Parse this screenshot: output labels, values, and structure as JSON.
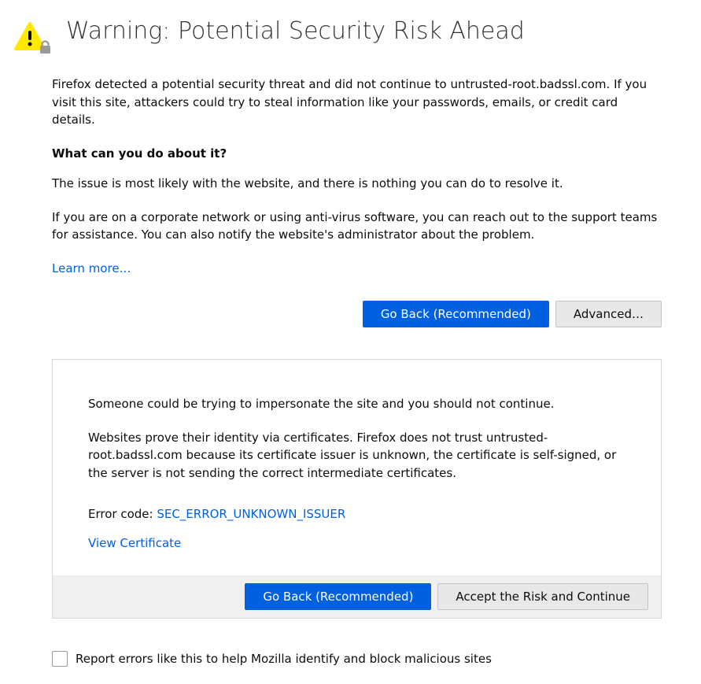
{
  "header": {
    "title": "Warning: Potential Security Risk Ahead"
  },
  "intro": "Firefox detected a potential security threat and did not continue to untrusted-root.badssl.com. If you visit this site, attackers could try to steal information like your passwords, emails, or credit card details.",
  "what_heading": "What can you do about it?",
  "what_line1": "The issue is most likely with the website, and there is nothing you can do to resolve it.",
  "what_line2": "If you are on a corporate network or using anti-virus software, you can reach out to the support teams for assistance. You can also notify the website's administrator about the problem.",
  "learn_more": "Learn more…",
  "buttons": {
    "go_back": "Go Back (Recommended)",
    "advanced": "Advanced…",
    "accept_risk": "Accept the Risk and Continue"
  },
  "advanced": {
    "line1": "Someone could be trying to impersonate the site and you should not continue.",
    "line2": "Websites prove their identity via certificates. Firefox does not trust untrusted-root.badssl.com because its certificate issuer is unknown, the certificate is self-signed, or the server is not sending the correct intermediate certificates.",
    "error_code_label": "Error code: ",
    "error_code": "SEC_ERROR_UNKNOWN_ISSUER",
    "view_certificate": "View Certificate"
  },
  "report_label": "Report errors like this to help Mozilla identify and block malicious sites"
}
